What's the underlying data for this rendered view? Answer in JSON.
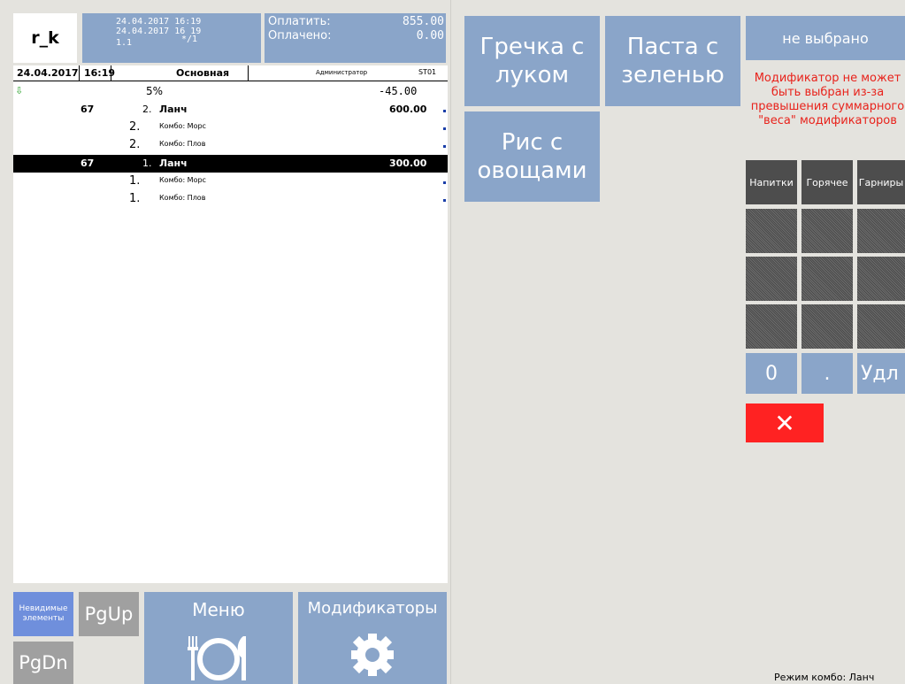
{
  "header": {
    "logo": "r_k",
    "info_line1": "24.04.2017 16:19",
    "info_line2": "24.04.2017 16 19",
    "info_line3": "1.1",
    "info_guests": "*/1",
    "pay_label": "Оплатить:",
    "pay_value": "855.00",
    "paid_label": "Оплачено:",
    "paid_value": "0.00"
  },
  "order": {
    "header": {
      "date": "24.04.2017",
      "time": "16:19",
      "hall": "Основная",
      "user": "Администратор",
      "station": "ST01"
    },
    "discount": {
      "name": "5%",
      "amount": "-45.00"
    },
    "lines": [
      {
        "code": "67",
        "qty": "2.",
        "name": "Ланч",
        "price": "600.00",
        "selected": false
      },
      {
        "qty": "2.",
        "name": "Комбо: Морс",
        "sub": true
      },
      {
        "qty": "2.",
        "name": "Комбо: Плов",
        "sub": true
      },
      {
        "code": "67",
        "qty": "1.",
        "name": "Ланч",
        "price": "300.00",
        "selected": true
      },
      {
        "qty": "1.",
        "name": "Комбо: Морс",
        "sub": true
      },
      {
        "qty": "1.",
        "name": "Комбо: Плов",
        "sub": true
      }
    ]
  },
  "bottom": {
    "hidden_label": "Невидимые элементы",
    "pgup_label": "PgUp",
    "pgdn_label": "PgDn",
    "menu_label": "Меню",
    "modifiers_label": "Модификаторы"
  },
  "dishes": {
    "dish1": "Гречка с луком",
    "dish2": "Паста с зеленью",
    "dish3": "Рис с овощами"
  },
  "modifier_panel": {
    "not_selected": "не выбрано",
    "warning": "Модификатор не может быть выбран из-за превышения суммарного \"веса\" модификаторов",
    "tabs": [
      "Напитки",
      "Горячее",
      "Гарниры"
    ],
    "keys": [
      "0",
      ".",
      "Удл"
    ],
    "combo_mode": "Режим комбо: Ланч"
  },
  "colors": {
    "tile": "#8aa5c9",
    "cancel": "#ff2222",
    "warning": "#e8221b"
  }
}
